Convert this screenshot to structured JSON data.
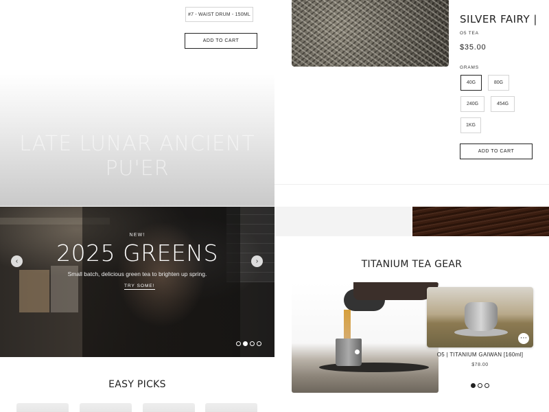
{
  "top_left": {
    "variant_label": "#7 - WAIST DRUM - 150ML",
    "add_to_cart": "ADD TO CART",
    "ghost_title_line1": "LATE LUNAR ANCIENT",
    "ghost_title_line2": "PU'ER"
  },
  "product": {
    "title": "SILVER FAIRY |",
    "vendor": "O5 TEA",
    "price": "$35.00",
    "grams_label": "GRAMS",
    "options": [
      "40G",
      "80G",
      "240G",
      "454G",
      "1KG"
    ],
    "selected": "40G",
    "add_to_cart": "ADD TO CART"
  },
  "hero": {
    "eyebrow": "NEW!",
    "headline": "2025 GREENS",
    "subtitle": "Small batch, delicious green tea to brighten up spring.",
    "cta": "TRY SOME!",
    "prev_icon": "chevron-left-icon",
    "next_icon": "chevron-right-icon",
    "slide_count": 4,
    "active_slide": 2
  },
  "easy_picks": {
    "title": "EASY PICKS"
  },
  "tea_gear": {
    "title": "TITANIUM TEA GEAR",
    "product_name": "O5 | TITANIUM GAIWAN [160ml]",
    "product_price": "$78.00",
    "more_icon": "more-horizontal-icon",
    "dots": 3,
    "active_dot": 1
  }
}
